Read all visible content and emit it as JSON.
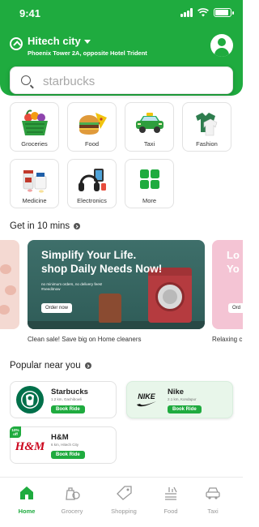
{
  "status": {
    "time": "9:41",
    "battery_level": 0.9
  },
  "location": {
    "city": "Hitech city",
    "address": "Phoenix Tower 2A, opposite Hotel Trident"
  },
  "search": {
    "placeholder": "starbucks"
  },
  "categories": [
    {
      "label": "Groceries",
      "icon": "grocery-basket-icon"
    },
    {
      "label": "Food",
      "icon": "burger-icon"
    },
    {
      "label": "Taxi",
      "icon": "taxi-icon"
    },
    {
      "label": "Fashion",
      "icon": "clothes-icon"
    },
    {
      "label": "Medicine",
      "icon": "pills-icon"
    },
    {
      "label": "Electronics",
      "icon": "headphones-icon"
    },
    {
      "label": "More",
      "icon": "grid-icon"
    }
  ],
  "quick_section": {
    "title": "Get in 10 mins"
  },
  "banners": {
    "main": {
      "headline_1": "Simplify Your Life.",
      "headline_2": "shop Daily Needs Now!",
      "subtext_1": "no minimum orders, no delivery fees!",
      "subtext_2": "#needitnow",
      "button": "Order now",
      "caption": "Clean sale! Save big on Home cleaners"
    },
    "right": {
      "headline_1": "Lo",
      "headline_2": "Yo",
      "button": "Ord",
      "caption": "Relaxing c"
    }
  },
  "popular_section": {
    "title": "Popular near you"
  },
  "stores": [
    {
      "name": "Starbucks",
      "meta": "1.2 km, Gachibowli",
      "button": "Book Ride",
      "logo": "starbucks-logo-icon"
    },
    {
      "name": "Nike",
      "meta": "2.1 km, Kondapur",
      "button": "Book Ride",
      "logo": "nike-logo-icon",
      "logo_text": "NIKE"
    },
    {
      "name": "H&M",
      "meta": "6 km, Hitech City",
      "button": "Book Ride",
      "logo": "hm-logo-icon",
      "logo_text": "H&M",
      "badge": "10% off"
    }
  ],
  "nav": [
    {
      "label": "Home",
      "icon": "home-icon",
      "active": true
    },
    {
      "label": "Grocery",
      "icon": "grocery-icon",
      "active": false
    },
    {
      "label": "Shopping",
      "icon": "tag-icon",
      "active": false
    },
    {
      "label": "Food",
      "icon": "food-icon",
      "active": false
    },
    {
      "label": "Taxi",
      "icon": "taxi-nav-icon",
      "active": false
    }
  ],
  "colors": {
    "brand_green": "#1fab3f",
    "starbucks_green": "#00704a",
    "hm_red": "#cc071e"
  }
}
